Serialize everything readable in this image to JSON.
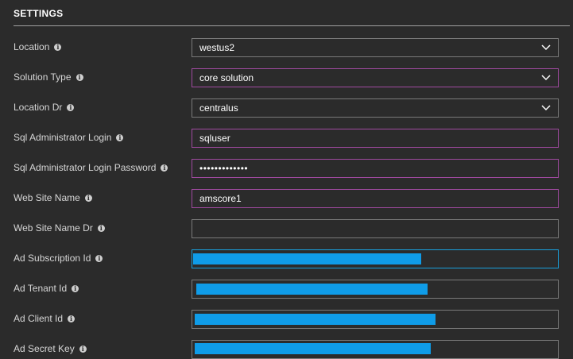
{
  "section": {
    "title": "SETTINGS"
  },
  "fields": {
    "location": {
      "label": "Location",
      "value": "westus2"
    },
    "solution_type": {
      "label": "Solution Type",
      "value": "core solution"
    },
    "location_dr": {
      "label": "Location Dr",
      "value": "centralus"
    },
    "sql_admin_login": {
      "label": "Sql Administrator Login",
      "value": "sqluser"
    },
    "sql_admin_password": {
      "label": "Sql Administrator Login Password",
      "value": "•••••••••••••"
    },
    "web_site_name": {
      "label": "Web Site Name",
      "value": "amscore1"
    },
    "web_site_name_dr": {
      "label": "Web Site Name Dr",
      "value": ""
    },
    "ad_subscription_id": {
      "label": "Ad Subscription Id"
    },
    "ad_tenant_id": {
      "label": "Ad Tenant Id"
    },
    "ad_client_id": {
      "label": "Ad Client Id"
    },
    "ad_secret_key": {
      "label": "Ad Secret Key"
    }
  },
  "icons": {
    "info": "info-icon",
    "dropdown": "chevron-down-icon"
  },
  "colors": {
    "background": "#2b2b2b",
    "modified_border": "#a04aa0",
    "focus_border": "#1aa0dc",
    "redaction": "#0f9ce8"
  }
}
